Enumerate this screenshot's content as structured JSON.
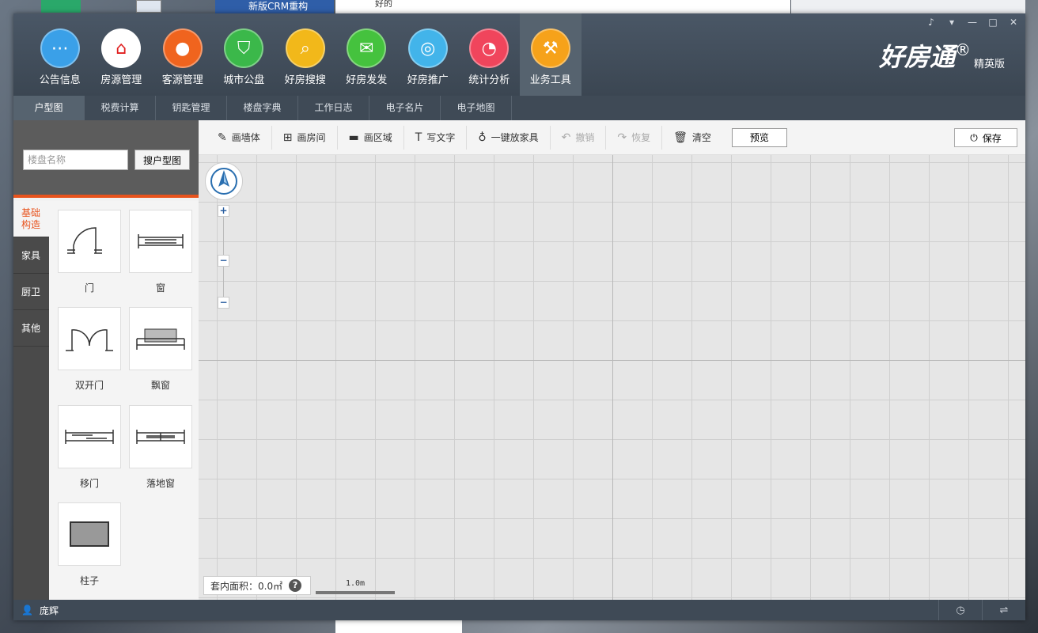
{
  "desktop": {
    "crm_title": "新版CRM重构",
    "chat_snippet": "好的"
  },
  "header": {
    "nav": [
      {
        "label": "公告信息",
        "icon": "chat-bubble-icon",
        "color": "#3aa0e8"
      },
      {
        "label": "房源管理",
        "icon": "house-icon",
        "color": "#ffffff"
      },
      {
        "label": "客源管理",
        "icon": "person-icon",
        "color": "#f0641e"
      },
      {
        "label": "城市公盘",
        "icon": "shield-icon",
        "color": "#3bb84a"
      },
      {
        "label": "好房搜搜",
        "icon": "search-icon",
        "color": "#f2b81a"
      },
      {
        "label": "好房发发",
        "icon": "envelope-icon",
        "color": "#45c23e"
      },
      {
        "label": "好房推广",
        "icon": "promote-icon",
        "color": "#42b4ea"
      },
      {
        "label": "统计分析",
        "icon": "pie-chart-icon",
        "color": "#f0455c"
      },
      {
        "label": "业务工具",
        "icon": "hammer-icon",
        "color": "#f6a21a"
      }
    ],
    "brand": {
      "name": "好房通",
      "reg": "®",
      "edition": "精英版"
    }
  },
  "subnav": [
    "户型图",
    "税费计算",
    "钥匙管理",
    "楼盘字典",
    "工作日志",
    "电子名片",
    "电子地图"
  ],
  "left": {
    "search_placeholder": "楼盘名称",
    "search_button": "搜户型图",
    "categories": [
      "基础\n构造",
      "家具",
      "厨卫",
      "其他"
    ],
    "items": [
      "门",
      "窗",
      "双开门",
      "飘窗",
      "移门",
      "落地窗",
      "柱子"
    ]
  },
  "toolbar": {
    "draw_wall": "画墙体",
    "draw_room": "画房间",
    "draw_area": "画区域",
    "write_text": "写文字",
    "place_furniture": "一键放家具",
    "undo": "撤销",
    "redo": "恢复",
    "clear": "清空",
    "preview": "预览",
    "save": "保存"
  },
  "canvas": {
    "area_label": "套内面积：0.0㎡",
    "help": "?",
    "scale_label": "1.0m"
  },
  "status": {
    "user": "庞辉"
  },
  "colors": {
    "accent": "#e8531d",
    "header": "#4a5766"
  }
}
